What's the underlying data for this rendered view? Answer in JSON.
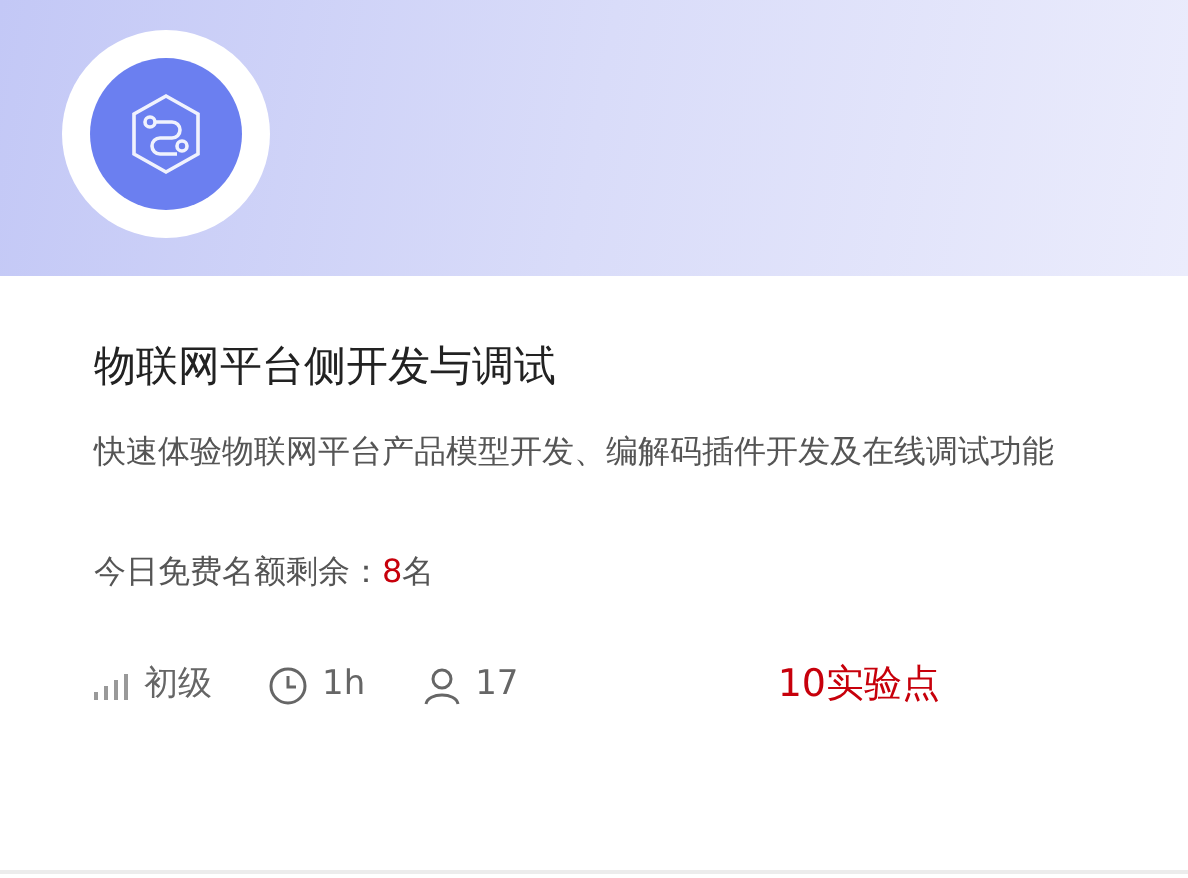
{
  "course": {
    "title": "物联网平台侧开发与调试",
    "description": "快速体验物联网平台产品模型开发、编解码插件开发及在线调试功能",
    "quota": {
      "label": "今日免费名额剩余：",
      "count": "8",
      "unit": "名"
    },
    "meta": [
      {
        "kind": "level",
        "text": "初级"
      },
      {
        "kind": "duration",
        "text": "1h"
      },
      {
        "kind": "learners",
        "text": "17"
      }
    ],
    "price": "10实验点"
  }
}
